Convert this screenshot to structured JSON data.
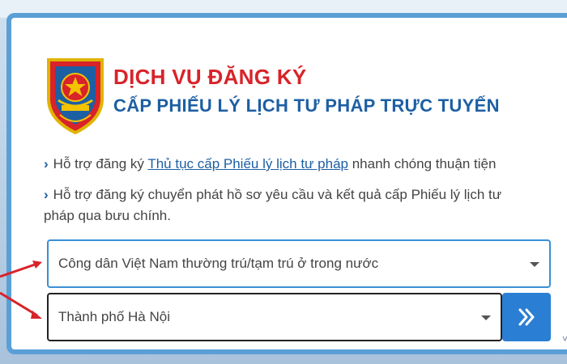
{
  "header": {
    "title_line1": "DỊCH VỤ ĐĂNG KÝ",
    "title_line2": "CẤP PHIẾU LÝ LỊCH TƯ PHÁP TRỰC TUYẾN"
  },
  "info": {
    "line1_prefix": "Hỗ trợ đăng ký ",
    "line1_link": "Thủ tục cấp Phiếu lý lịch tư pháp",
    "line1_suffix": " nhanh chóng thuận tiện",
    "line2a": "Hỗ trợ đăng ký chuyển phát hồ sơ yêu cầu và kết quả cấp Phiếu lý lịch tư",
    "line2b": "pháp qua bưu chính."
  },
  "form": {
    "citizen_type_selected": "Công dân Việt Nam thường trú/tạm trú ở trong nước",
    "city_selected": "Thành phố Hà Nội"
  },
  "icons": {
    "logo": "police-emblem-icon",
    "bullet": "chevron-right-icon",
    "dropdown": "caret-down-icon",
    "submit": "double-chevron-right-icon",
    "annotation": "red-arrow-icon"
  },
  "colors": {
    "title_red": "#d8232a",
    "title_blue": "#1d5fa3",
    "accent_blue": "#2a7fd4",
    "card_border": "#5a9fd6"
  }
}
